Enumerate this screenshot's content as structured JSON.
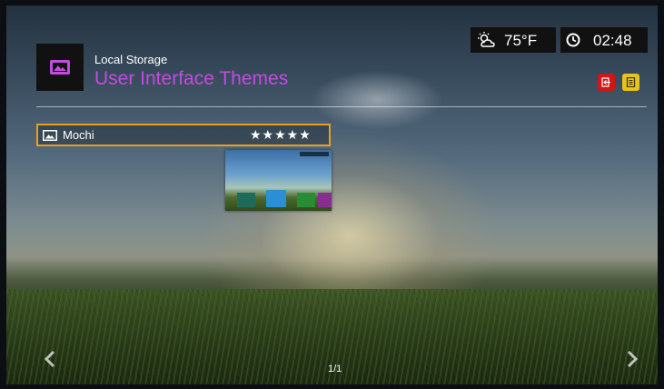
{
  "header": {
    "breadcrumb": "Local Storage",
    "title": "User Interface Themes",
    "section_icon": "image-icon",
    "title_color": "#c34be0"
  },
  "status": {
    "weather_icon": "partly-sunny-icon",
    "temperature": "75°F",
    "clock_icon": "clock-icon",
    "time": "02:48"
  },
  "action_buttons": [
    {
      "name": "exit-button",
      "icon": "exit-icon",
      "color": "#d01616"
    },
    {
      "name": "menu-button",
      "icon": "menu-list-icon",
      "color": "#e6c419"
    }
  ],
  "themes": [
    {
      "name": "Mochi",
      "rating": "★★★★★",
      "icon": "image-icon",
      "selected": true
    }
  ],
  "selection_color": "#e8a020",
  "pager": {
    "label": "1/1"
  },
  "navigation": {
    "prev_icon": "chevron-left-icon",
    "next_icon": "chevron-right-icon"
  }
}
